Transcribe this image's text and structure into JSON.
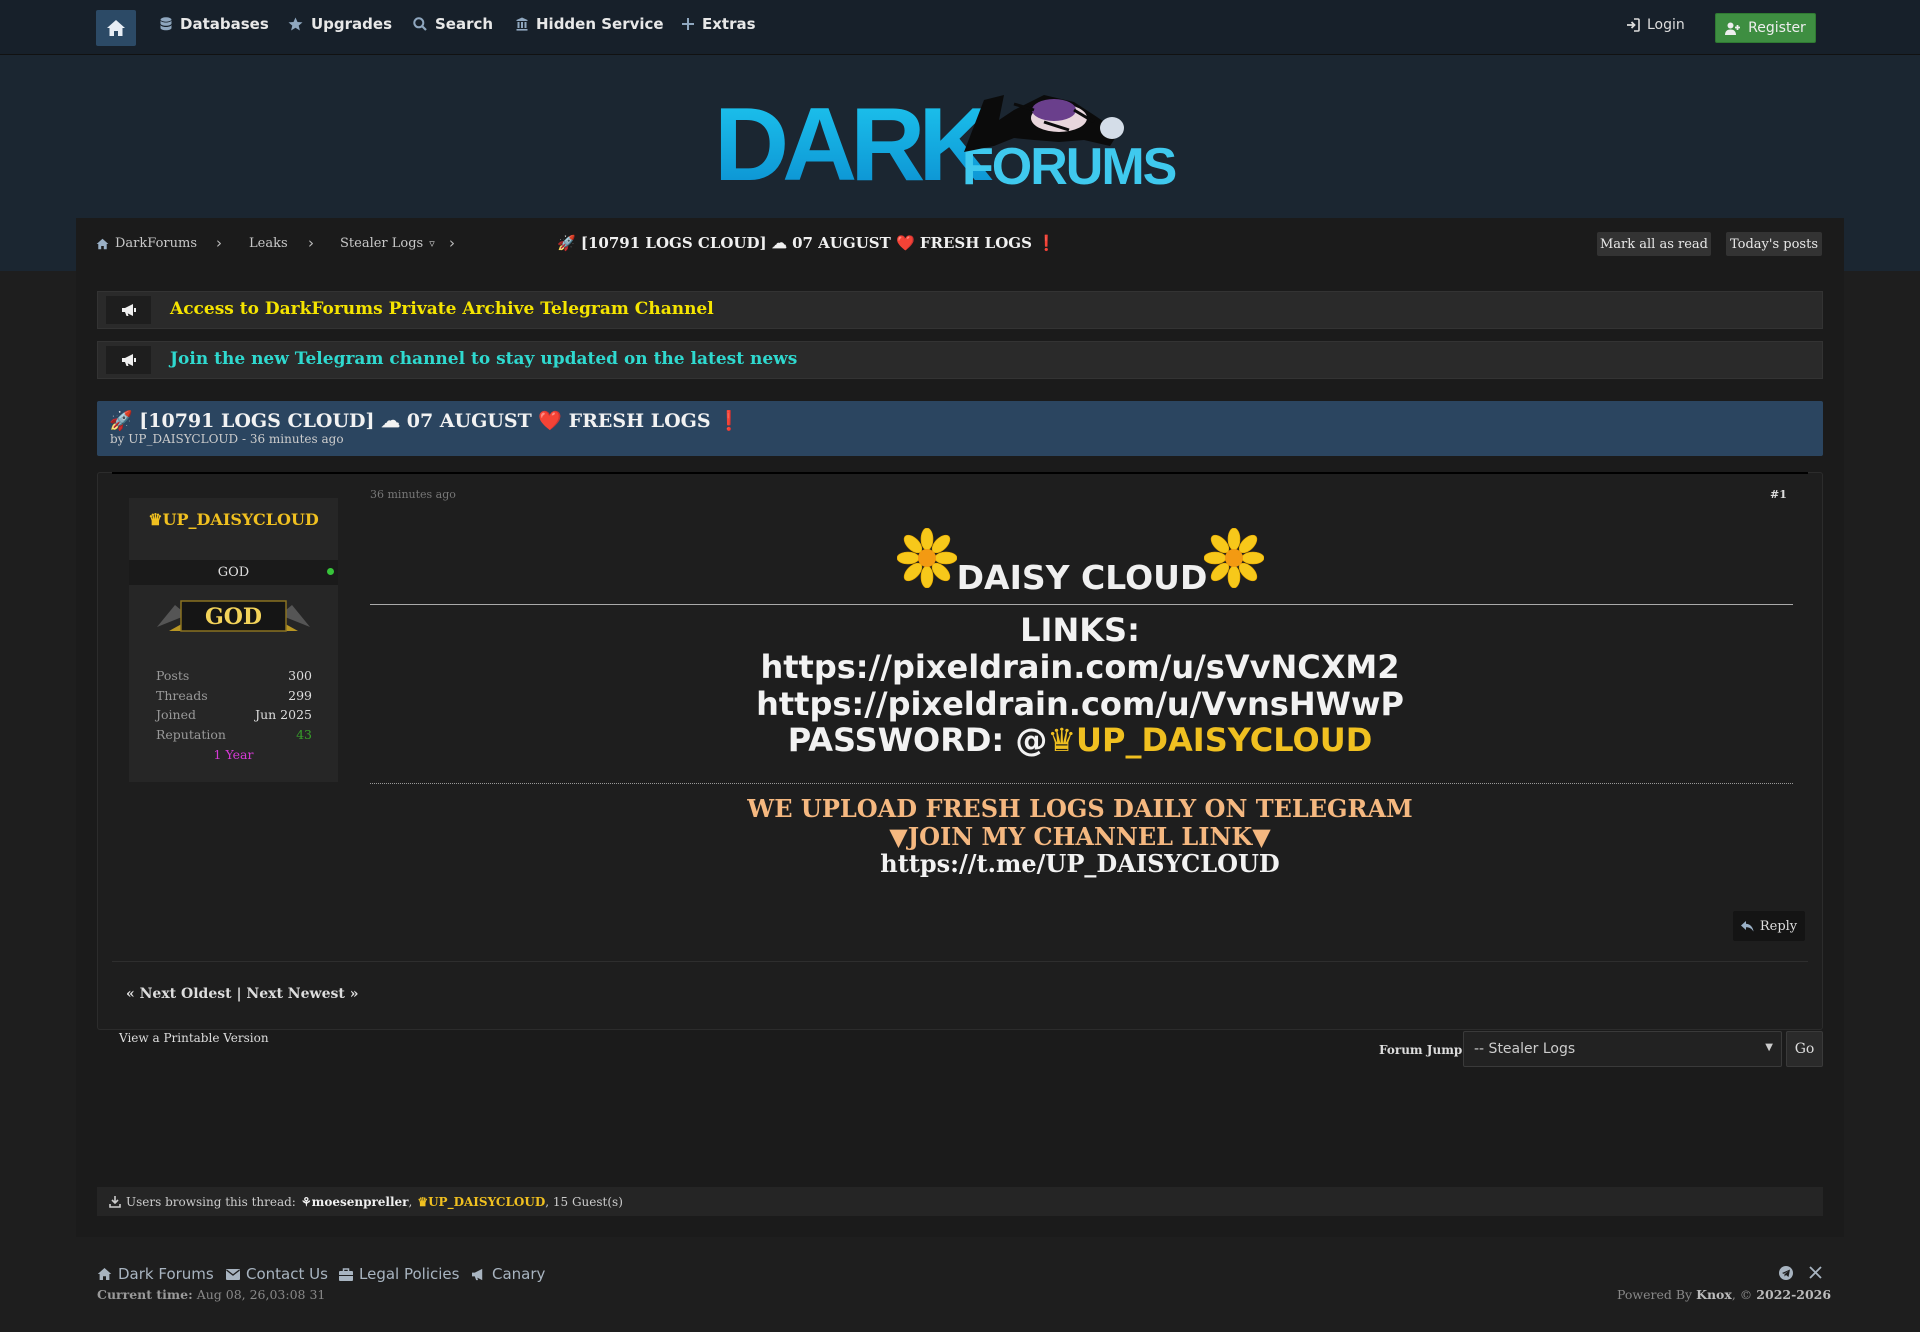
{
  "nav": {
    "items": [
      {
        "label": "Databases",
        "icon": "database-icon"
      },
      {
        "label": "Upgrades",
        "icon": "star-icon"
      },
      {
        "label": "Search",
        "icon": "search-icon"
      },
      {
        "label": "Hidden Service",
        "icon": "building-icon"
      },
      {
        "label": "Extras",
        "icon": "plus-icon"
      }
    ],
    "login": "Login",
    "register": "Register"
  },
  "logo": {
    "text1": "DARK",
    "text2": "FORUMS"
  },
  "breadcrumb": {
    "items": [
      "DarkForums",
      "Leaks",
      "Stealer Logs"
    ],
    "dropdown_marker": "▿",
    "current": "🚀 [10791 LOGS CLOUD] ☁ 07 AUGUST ❤️ FRESH LOGS ❗",
    "mark_read": "Mark all as read",
    "todays_posts": "Today's posts"
  },
  "announcements": [
    {
      "text": "Access to DarkForums Private Archive Telegram Channel",
      "color": "#f5e400"
    },
    {
      "text": "Join the new Telegram channel to stay updated on the latest news",
      "color": "#2fd9cf"
    }
  ],
  "thread": {
    "title": "🚀 [10791 LOGS CLOUD] ☁ 07 AUGUST ❤️ FRESH LOGS ❗",
    "by": "by UP_DAISYCLOUD - 36 minutes ago"
  },
  "author": {
    "name": "♛UP_DAISYCLOUD",
    "rank": "GOD",
    "badge": "GOD",
    "stats": [
      {
        "k": "Posts",
        "v": "300"
      },
      {
        "k": "Threads",
        "v": "299"
      },
      {
        "k": "Joined",
        "v": "Jun 2025"
      },
      {
        "k": "Reputation",
        "v": "43"
      }
    ],
    "tenure": "1 Year"
  },
  "post": {
    "date": "36 minutes ago",
    "number": "#1",
    "heading": "DAISY CLOUD",
    "links_label": "LINKS:",
    "link1": "https://pixeldrain.com/u/sVvNCXM2",
    "link2": "https://pixeldrain.com/u/VvnsHWwP",
    "password_label": "PASSWORD: @",
    "password_value": "♛UP_DAISYCLOUD",
    "upload_line": "WE UPLOAD FRESH LOGS DAILY ON TELEGRAM",
    "join_line": "▼JOIN MY CHANNEL LINK▼",
    "telegram": "https://t.me/UP_DAISYCLOUD",
    "reply": "Reply"
  },
  "thread_nav": "« Next Oldest | Next Newest »",
  "printable": "View a Printable Version",
  "forum_jump": {
    "label": "Forum Jump:",
    "selected": "-- Stealer Logs",
    "go": "Go"
  },
  "browsing": {
    "prefix": "Users browsing this thread:",
    "user1": "⚘moesenpreller",
    "sep": ",",
    "user2": "♛UP_DAISYCLOUD",
    "suffix": ", 15 Guest(s)"
  },
  "footer": {
    "links": [
      "Dark Forums",
      "Contact Us",
      "Legal Policies",
      "Canary"
    ],
    "current_time_label": "Current time:",
    "current_time": "Aug 08, 26,03:08 31",
    "powered_prefix": "Powered By",
    "powered_name": "Knox",
    "powered_suffix": ", ©",
    "years": "2022-2026"
  },
  "colors": {
    "accent": "#2b4560",
    "gold": "#f0c020",
    "register": "#3e8e41",
    "rep": "#37a02a",
    "tenure": "#d63ad6",
    "orange": "#f5b880"
  }
}
